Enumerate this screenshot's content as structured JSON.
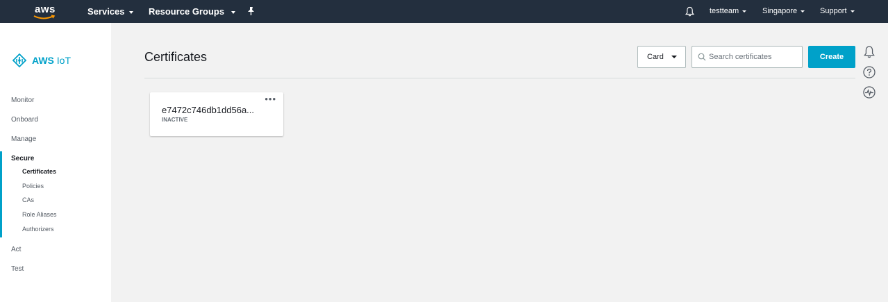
{
  "topbar": {
    "logo": "aws",
    "services_label": "Services",
    "resource_groups_label": "Resource Groups",
    "bell_icon": "bell-icon",
    "pin_icon": "pin-icon",
    "account_label": "testteam",
    "region_label": "Singapore",
    "support_label": "Support"
  },
  "sidebar": {
    "brand_prefix": "AWS",
    "brand_suffix": "IoT",
    "items": [
      {
        "label": "Monitor"
      },
      {
        "label": "Onboard"
      },
      {
        "label": "Manage"
      },
      {
        "label": "Secure"
      },
      {
        "label": "Act"
      },
      {
        "label": "Test"
      }
    ],
    "secure_children": [
      {
        "label": "Certificates"
      },
      {
        "label": "Policies"
      },
      {
        "label": "CAs"
      },
      {
        "label": "Role Aliases"
      },
      {
        "label": "Authorizers"
      }
    ]
  },
  "main": {
    "title": "Certificates",
    "view_select": "Card",
    "search_placeholder": "Search certificates",
    "create_label": "Create",
    "card": {
      "menu": "•••",
      "cert_id": "e7472c746db1dd56a...",
      "status": "INACTIVE"
    }
  },
  "colors": {
    "topbar_bg": "#232f3e",
    "accent": "#00a1c9",
    "page_bg": "#f2f2f2"
  }
}
